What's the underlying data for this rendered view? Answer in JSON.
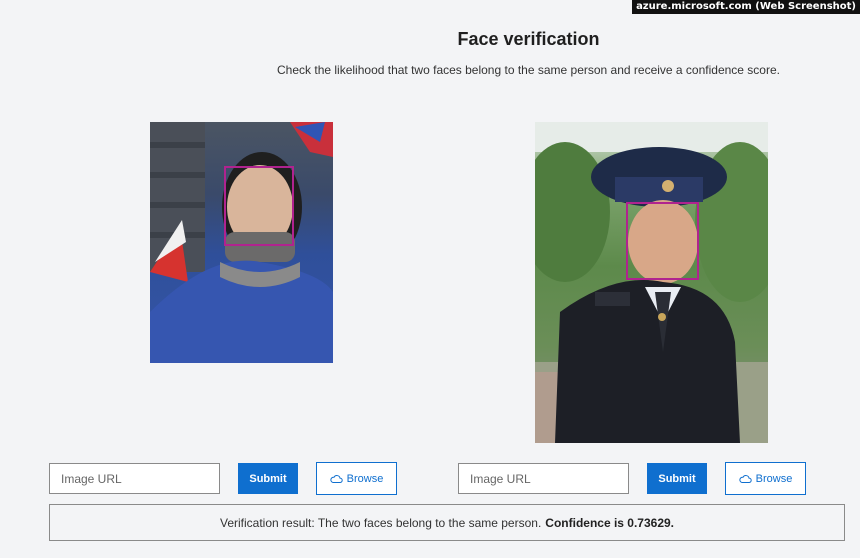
{
  "watermark": "azure.microsoft.com (Web Screenshot)",
  "header": {
    "title": "Face verification",
    "subtitle": "Check the likelihood that two faces belong to the same person and receive a confidence score."
  },
  "left_panel": {
    "url_placeholder": "Image URL",
    "submit_label": "Submit",
    "browse_label": "Browse",
    "browse_icon": "cloud-upload-icon"
  },
  "right_panel": {
    "url_placeholder": "Image URL",
    "submit_label": "Submit",
    "browse_label": "Browse",
    "browse_icon": "cloud-upload-icon"
  },
  "result": {
    "text": "Verification result: The two faces belong to the same person.",
    "confidence": "Confidence is 0.73629."
  },
  "colors": {
    "accent": "#0f6fcf",
    "face_box": "#b0238f",
    "background": "#f3f4f6"
  }
}
